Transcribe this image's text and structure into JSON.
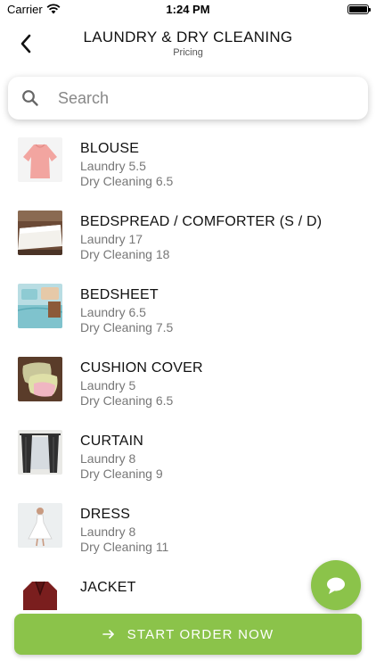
{
  "status_bar": {
    "carrier": "Carrier",
    "time": "1:24 PM"
  },
  "header": {
    "title": "LAUNDRY & DRY CLEANING",
    "subtitle": "Pricing"
  },
  "search": {
    "placeholder": "Search"
  },
  "items": [
    {
      "name": "BLOUSE",
      "laundry": "Laundry 5.5",
      "dry_cleaning": "Dry Cleaning 6.5",
      "icon": "blouse-image"
    },
    {
      "name": "BEDSPREAD / COMFORTER (S / D)",
      "laundry": "Laundry 17",
      "dry_cleaning": "Dry Cleaning 18",
      "icon": "bedspread-image"
    },
    {
      "name": "BEDSHEET",
      "laundry": "Laundry 6.5",
      "dry_cleaning": "Dry Cleaning 7.5",
      "icon": "bedsheet-image"
    },
    {
      "name": "CUSHION COVER",
      "laundry": "Laundry 5",
      "dry_cleaning": "Dry Cleaning 6.5",
      "icon": "cushion-image"
    },
    {
      "name": "CURTAIN",
      "laundry": "Laundry 8",
      "dry_cleaning": "Dry Cleaning 9",
      "icon": "curtain-image"
    },
    {
      "name": "DRESS",
      "laundry": "Laundry 8",
      "dry_cleaning": "Dry Cleaning 11",
      "icon": "dress-image"
    },
    {
      "name": "JACKET",
      "laundry": "",
      "dry_cleaning": "",
      "icon": "jacket-image"
    }
  ],
  "cta": {
    "label": "START ORDER NOW",
    "icon": "arrow-right-icon"
  },
  "fab": {
    "icon": "chat-icon"
  },
  "colors": {
    "accent": "#8bc34a",
    "text_secondary": "#777777"
  }
}
